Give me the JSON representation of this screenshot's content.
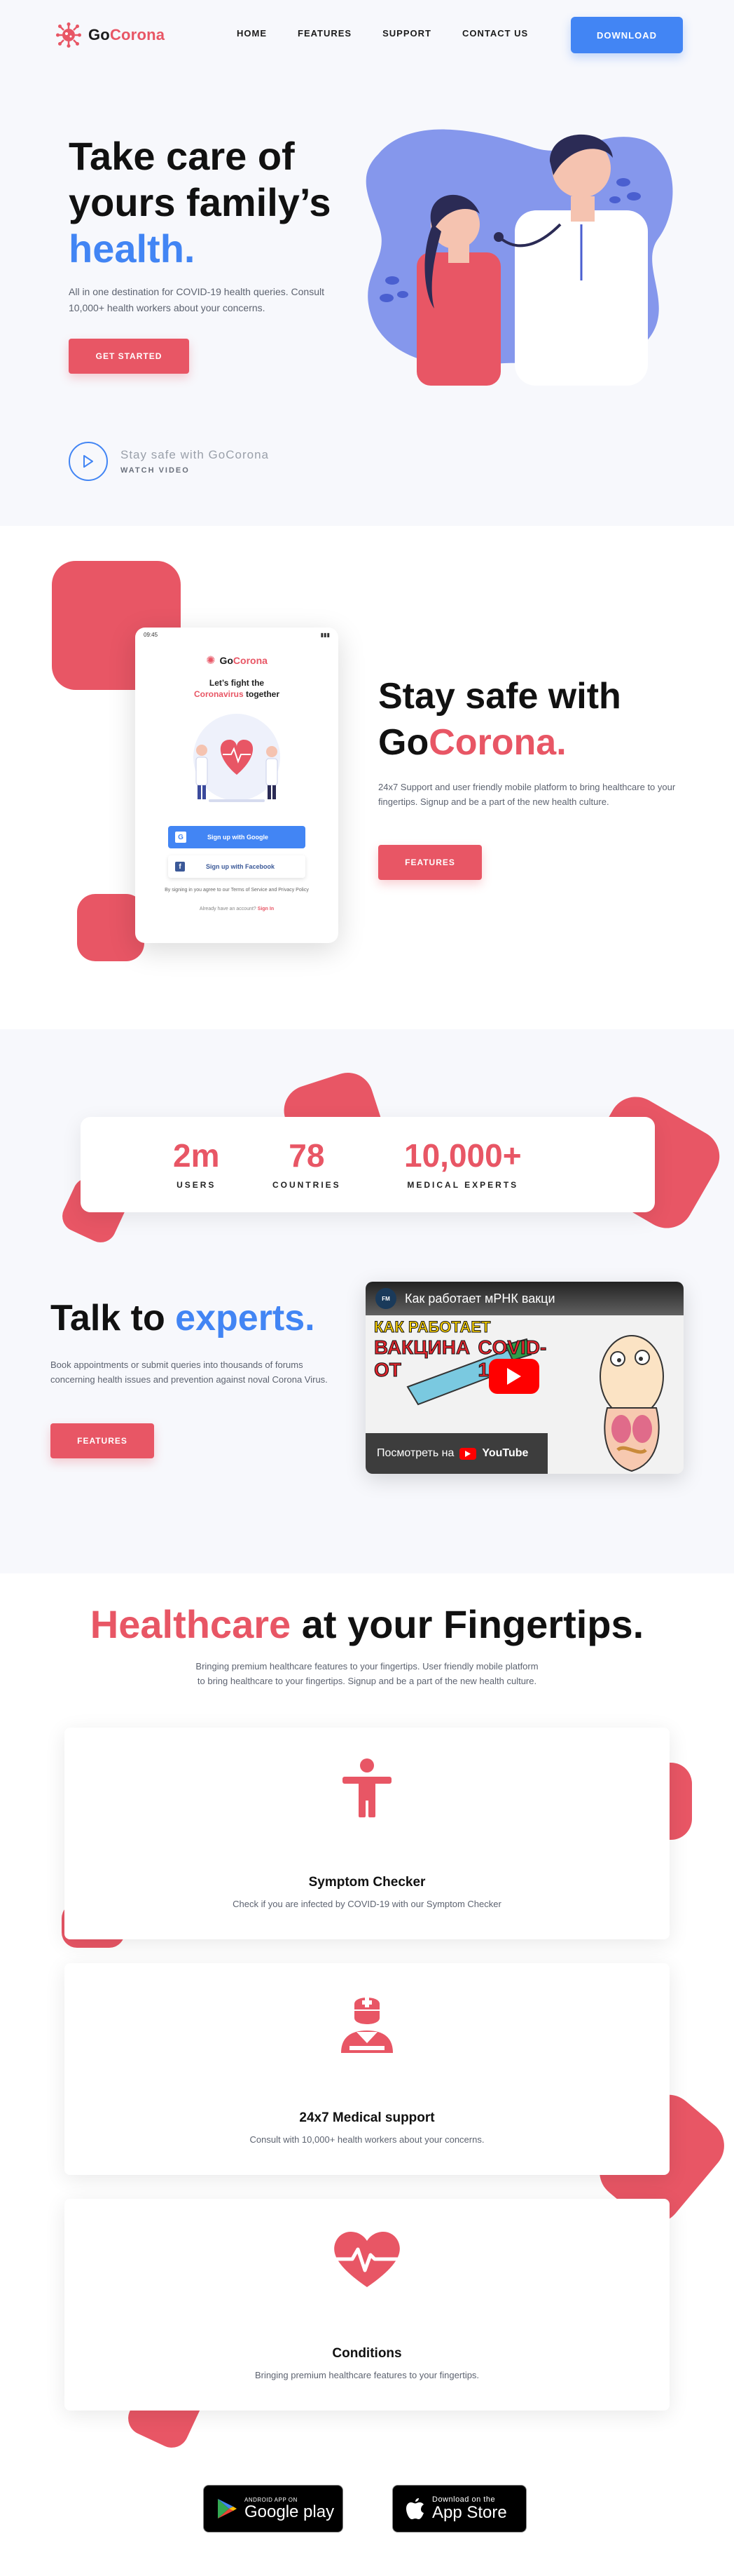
{
  "nav": {
    "logo_go": "Go",
    "logo_corona": "Corona",
    "links": [
      "HOME",
      "FEATURES",
      "SUPPORT",
      "CONTACT US"
    ],
    "download": "DOWNLOAD"
  },
  "hero": {
    "title_line1": "Take care of",
    "title_line2": "yours family’s",
    "title_highlight": "health.",
    "desc": "All in one destination for COVID-19 health queries. Consult 10,000+ health workers about your concerns.",
    "cta": "GET STARTED",
    "video_title": "Stay safe with GoCorona",
    "video_sub": "WATCH VIDEO"
  },
  "phone": {
    "time": "09:45",
    "logo_go": "Go",
    "logo_corona": "Corona",
    "fight_line1": "Let’s fight the",
    "fight_highlight": "Coronavirus",
    "fight_rest": "together",
    "google_btn": "Sign up with Google",
    "fb_btn": "Sign up with Facebook",
    "terms": "By signing in you agree to our Terms of Service and Privacy Policy",
    "account": "Already have an account?",
    "signin": "Sign In"
  },
  "section2": {
    "title_line1": "Stay safe with",
    "title_go": "Go",
    "title_corona": "Corona.",
    "desc": "24x7 Support and user friendly mobile platform to bring healthcare to your fingertips. Signup and be a part of the new health culture.",
    "cta": "FEATURES"
  },
  "stats": [
    {
      "value": "2m",
      "label": "USERS"
    },
    {
      "value": "78",
      "label": "COUNTRIES"
    },
    {
      "value": "10,000+",
      "label": "MEDICAL EXPERTS"
    }
  ],
  "section3": {
    "title_plain": "Talk to ",
    "title_highlight": "experts.",
    "desc": "Book appointments or submit queries into thousands of forums concerning health issues and prevention against noval Corona Virus.",
    "cta": "FEATURES",
    "video": {
      "channel": "FM",
      "title": "Как работает мРНК вакци",
      "banner_line1": "КАК РАБОТАЕТ",
      "banner_line2": "ВАКЦИНА ОТ",
      "banner_line3": "COVID-19?",
      "watch_on": "Посмотреть на",
      "youtube": "YouTube"
    }
  },
  "section4": {
    "title_highlight": "Healthcare",
    "title_rest": " at your Fingertips.",
    "desc": "Bringing premium healthcare features to your fingertips. User friendly mobile platform to bring healthcare to your fingertips. Signup and be a part of the new health culture.",
    "cards": [
      {
        "icon": "person-icon",
        "title": "Symptom Checker",
        "desc": "Check if you are infected by COVID-19 with our Symptom Checker"
      },
      {
        "icon": "medic-icon",
        "title": "24x7 Medical support",
        "desc": "Consult with 10,000+ health workers about your concerns."
      },
      {
        "icon": "heartbeat-icon",
        "title": "Conditions",
        "desc": "Bringing premium healthcare features to your fingertips."
      }
    ],
    "google_play_small": "ANDROID APP ON",
    "google_play_big": "Google play",
    "app_store_small": "Download on the",
    "app_store_big": "App Store"
  },
  "colors": {
    "brand_red": "#e85665",
    "brand_blue": "#4285f4",
    "hero_bg": "#f7f8fc"
  }
}
